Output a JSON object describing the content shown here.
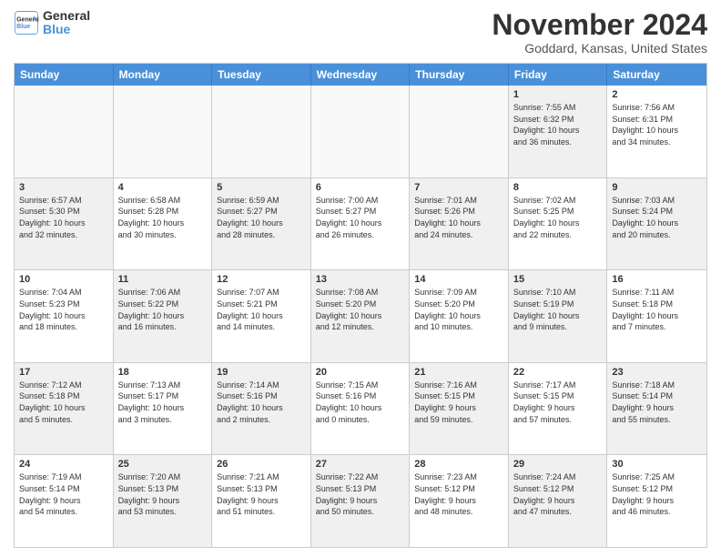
{
  "header": {
    "logo_line1": "General",
    "logo_line2": "Blue",
    "month": "November 2024",
    "location": "Goddard, Kansas, United States"
  },
  "weekdays": [
    "Sunday",
    "Monday",
    "Tuesday",
    "Wednesday",
    "Thursday",
    "Friday",
    "Saturday"
  ],
  "rows": [
    [
      {
        "day": "",
        "info": "",
        "empty": true
      },
      {
        "day": "",
        "info": "",
        "empty": true
      },
      {
        "day": "",
        "info": "",
        "empty": true
      },
      {
        "day": "",
        "info": "",
        "empty": true
      },
      {
        "day": "",
        "info": "",
        "empty": true
      },
      {
        "day": "1",
        "info": "Sunrise: 7:55 AM\nSunset: 6:32 PM\nDaylight: 10 hours\nand 36 minutes.",
        "shaded": true
      },
      {
        "day": "2",
        "info": "Sunrise: 7:56 AM\nSunset: 6:31 PM\nDaylight: 10 hours\nand 34 minutes.",
        "shaded": false
      }
    ],
    [
      {
        "day": "3",
        "info": "Sunrise: 6:57 AM\nSunset: 5:30 PM\nDaylight: 10 hours\nand 32 minutes.",
        "shaded": true
      },
      {
        "day": "4",
        "info": "Sunrise: 6:58 AM\nSunset: 5:28 PM\nDaylight: 10 hours\nand 30 minutes.",
        "shaded": false
      },
      {
        "day": "5",
        "info": "Sunrise: 6:59 AM\nSunset: 5:27 PM\nDaylight: 10 hours\nand 28 minutes.",
        "shaded": true
      },
      {
        "day": "6",
        "info": "Sunrise: 7:00 AM\nSunset: 5:27 PM\nDaylight: 10 hours\nand 26 minutes.",
        "shaded": false
      },
      {
        "day": "7",
        "info": "Sunrise: 7:01 AM\nSunset: 5:26 PM\nDaylight: 10 hours\nand 24 minutes.",
        "shaded": true
      },
      {
        "day": "8",
        "info": "Sunrise: 7:02 AM\nSunset: 5:25 PM\nDaylight: 10 hours\nand 22 minutes.",
        "shaded": false
      },
      {
        "day": "9",
        "info": "Sunrise: 7:03 AM\nSunset: 5:24 PM\nDaylight: 10 hours\nand 20 minutes.",
        "shaded": true
      }
    ],
    [
      {
        "day": "10",
        "info": "Sunrise: 7:04 AM\nSunset: 5:23 PM\nDaylight: 10 hours\nand 18 minutes.",
        "shaded": false
      },
      {
        "day": "11",
        "info": "Sunrise: 7:06 AM\nSunset: 5:22 PM\nDaylight: 10 hours\nand 16 minutes.",
        "shaded": true
      },
      {
        "day": "12",
        "info": "Sunrise: 7:07 AM\nSunset: 5:21 PM\nDaylight: 10 hours\nand 14 minutes.",
        "shaded": false
      },
      {
        "day": "13",
        "info": "Sunrise: 7:08 AM\nSunset: 5:20 PM\nDaylight: 10 hours\nand 12 minutes.",
        "shaded": true
      },
      {
        "day": "14",
        "info": "Sunrise: 7:09 AM\nSunset: 5:20 PM\nDaylight: 10 hours\nand 10 minutes.",
        "shaded": false
      },
      {
        "day": "15",
        "info": "Sunrise: 7:10 AM\nSunset: 5:19 PM\nDaylight: 10 hours\nand 9 minutes.",
        "shaded": true
      },
      {
        "day": "16",
        "info": "Sunrise: 7:11 AM\nSunset: 5:18 PM\nDaylight: 10 hours\nand 7 minutes.",
        "shaded": false
      }
    ],
    [
      {
        "day": "17",
        "info": "Sunrise: 7:12 AM\nSunset: 5:18 PM\nDaylight: 10 hours\nand 5 minutes.",
        "shaded": true
      },
      {
        "day": "18",
        "info": "Sunrise: 7:13 AM\nSunset: 5:17 PM\nDaylight: 10 hours\nand 3 minutes.",
        "shaded": false
      },
      {
        "day": "19",
        "info": "Sunrise: 7:14 AM\nSunset: 5:16 PM\nDaylight: 10 hours\nand 2 minutes.",
        "shaded": true
      },
      {
        "day": "20",
        "info": "Sunrise: 7:15 AM\nSunset: 5:16 PM\nDaylight: 10 hours\nand 0 minutes.",
        "shaded": false
      },
      {
        "day": "21",
        "info": "Sunrise: 7:16 AM\nSunset: 5:15 PM\nDaylight: 9 hours\nand 59 minutes.",
        "shaded": true
      },
      {
        "day": "22",
        "info": "Sunrise: 7:17 AM\nSunset: 5:15 PM\nDaylight: 9 hours\nand 57 minutes.",
        "shaded": false
      },
      {
        "day": "23",
        "info": "Sunrise: 7:18 AM\nSunset: 5:14 PM\nDaylight: 9 hours\nand 55 minutes.",
        "shaded": true
      }
    ],
    [
      {
        "day": "24",
        "info": "Sunrise: 7:19 AM\nSunset: 5:14 PM\nDaylight: 9 hours\nand 54 minutes.",
        "shaded": false
      },
      {
        "day": "25",
        "info": "Sunrise: 7:20 AM\nSunset: 5:13 PM\nDaylight: 9 hours\nand 53 minutes.",
        "shaded": true
      },
      {
        "day": "26",
        "info": "Sunrise: 7:21 AM\nSunset: 5:13 PM\nDaylight: 9 hours\nand 51 minutes.",
        "shaded": false
      },
      {
        "day": "27",
        "info": "Sunrise: 7:22 AM\nSunset: 5:13 PM\nDaylight: 9 hours\nand 50 minutes.",
        "shaded": true
      },
      {
        "day": "28",
        "info": "Sunrise: 7:23 AM\nSunset: 5:12 PM\nDaylight: 9 hours\nand 48 minutes.",
        "shaded": false
      },
      {
        "day": "29",
        "info": "Sunrise: 7:24 AM\nSunset: 5:12 PM\nDaylight: 9 hours\nand 47 minutes.",
        "shaded": true
      },
      {
        "day": "30",
        "info": "Sunrise: 7:25 AM\nSunset: 5:12 PM\nDaylight: 9 hours\nand 46 minutes.",
        "shaded": false
      }
    ]
  ]
}
